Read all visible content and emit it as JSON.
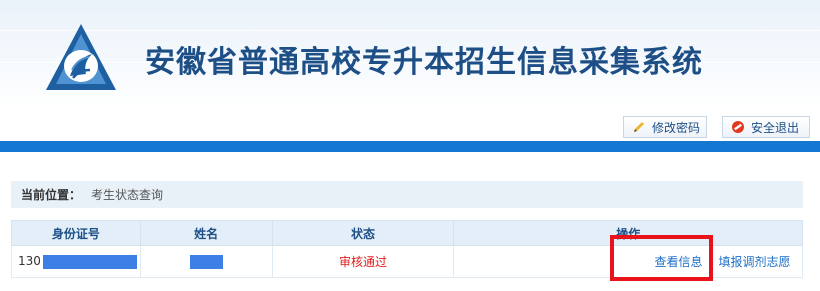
{
  "header": {
    "title": "安徽省普通高校专升本招生信息采集系统"
  },
  "toolbar": {
    "change_password": "修改密码",
    "logout": "安全退出"
  },
  "breadcrumb": {
    "label": "当前位置：",
    "value": "考生状态查询"
  },
  "table": {
    "headers": [
      "身份证号",
      "姓名",
      "状态",
      "操作"
    ],
    "rows": [
      {
        "id_prefix": "130",
        "status": "审核通过",
        "action_view": "查看信息",
        "action_fill": "填报调剂志愿"
      }
    ]
  },
  "colors": {
    "title": "#1d4f86",
    "bar": "#1477d2",
    "highlight": "#e8131b",
    "status": "#e02020",
    "mask": "#3e7fe6"
  }
}
